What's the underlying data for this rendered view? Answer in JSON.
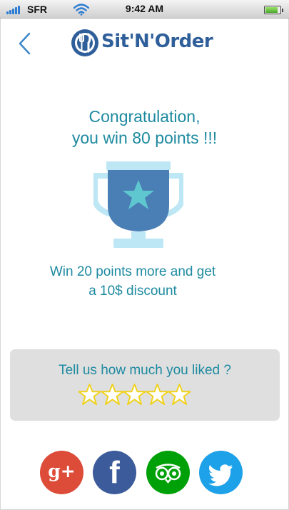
{
  "status_bar": {
    "carrier": "SFR",
    "time": "9:42 AM",
    "icons": [
      "signal-icon",
      "wifi-icon",
      "battery-icon"
    ],
    "battery_level": 0.85
  },
  "header": {
    "logo_text": "Sit'N'Order",
    "back_icon": "chevron-left-icon"
  },
  "congrats": {
    "line1": "Congratulation,",
    "line2": "you win 80 points !!!"
  },
  "bonus": {
    "line1": "Win 20 points more and get",
    "line2": "a 10$ discount"
  },
  "rating": {
    "title": "Tell us how much you liked ?",
    "max_stars": 5,
    "selected_stars": 0
  },
  "social": {
    "google_plus_label": "g+",
    "facebook_label": "f",
    "buttons": [
      "google-plus-icon",
      "facebook-icon",
      "tripadvisor-icon",
      "twitter-icon"
    ]
  },
  "colors": {
    "accent": "#1e8aa0",
    "brand": "#2f5f9a",
    "google_plus": "#dd4b39",
    "facebook": "#3b5b9a",
    "tripadvisor": "#00a008",
    "twitter": "#1da1e8",
    "star_outline": "#f0d21c"
  }
}
